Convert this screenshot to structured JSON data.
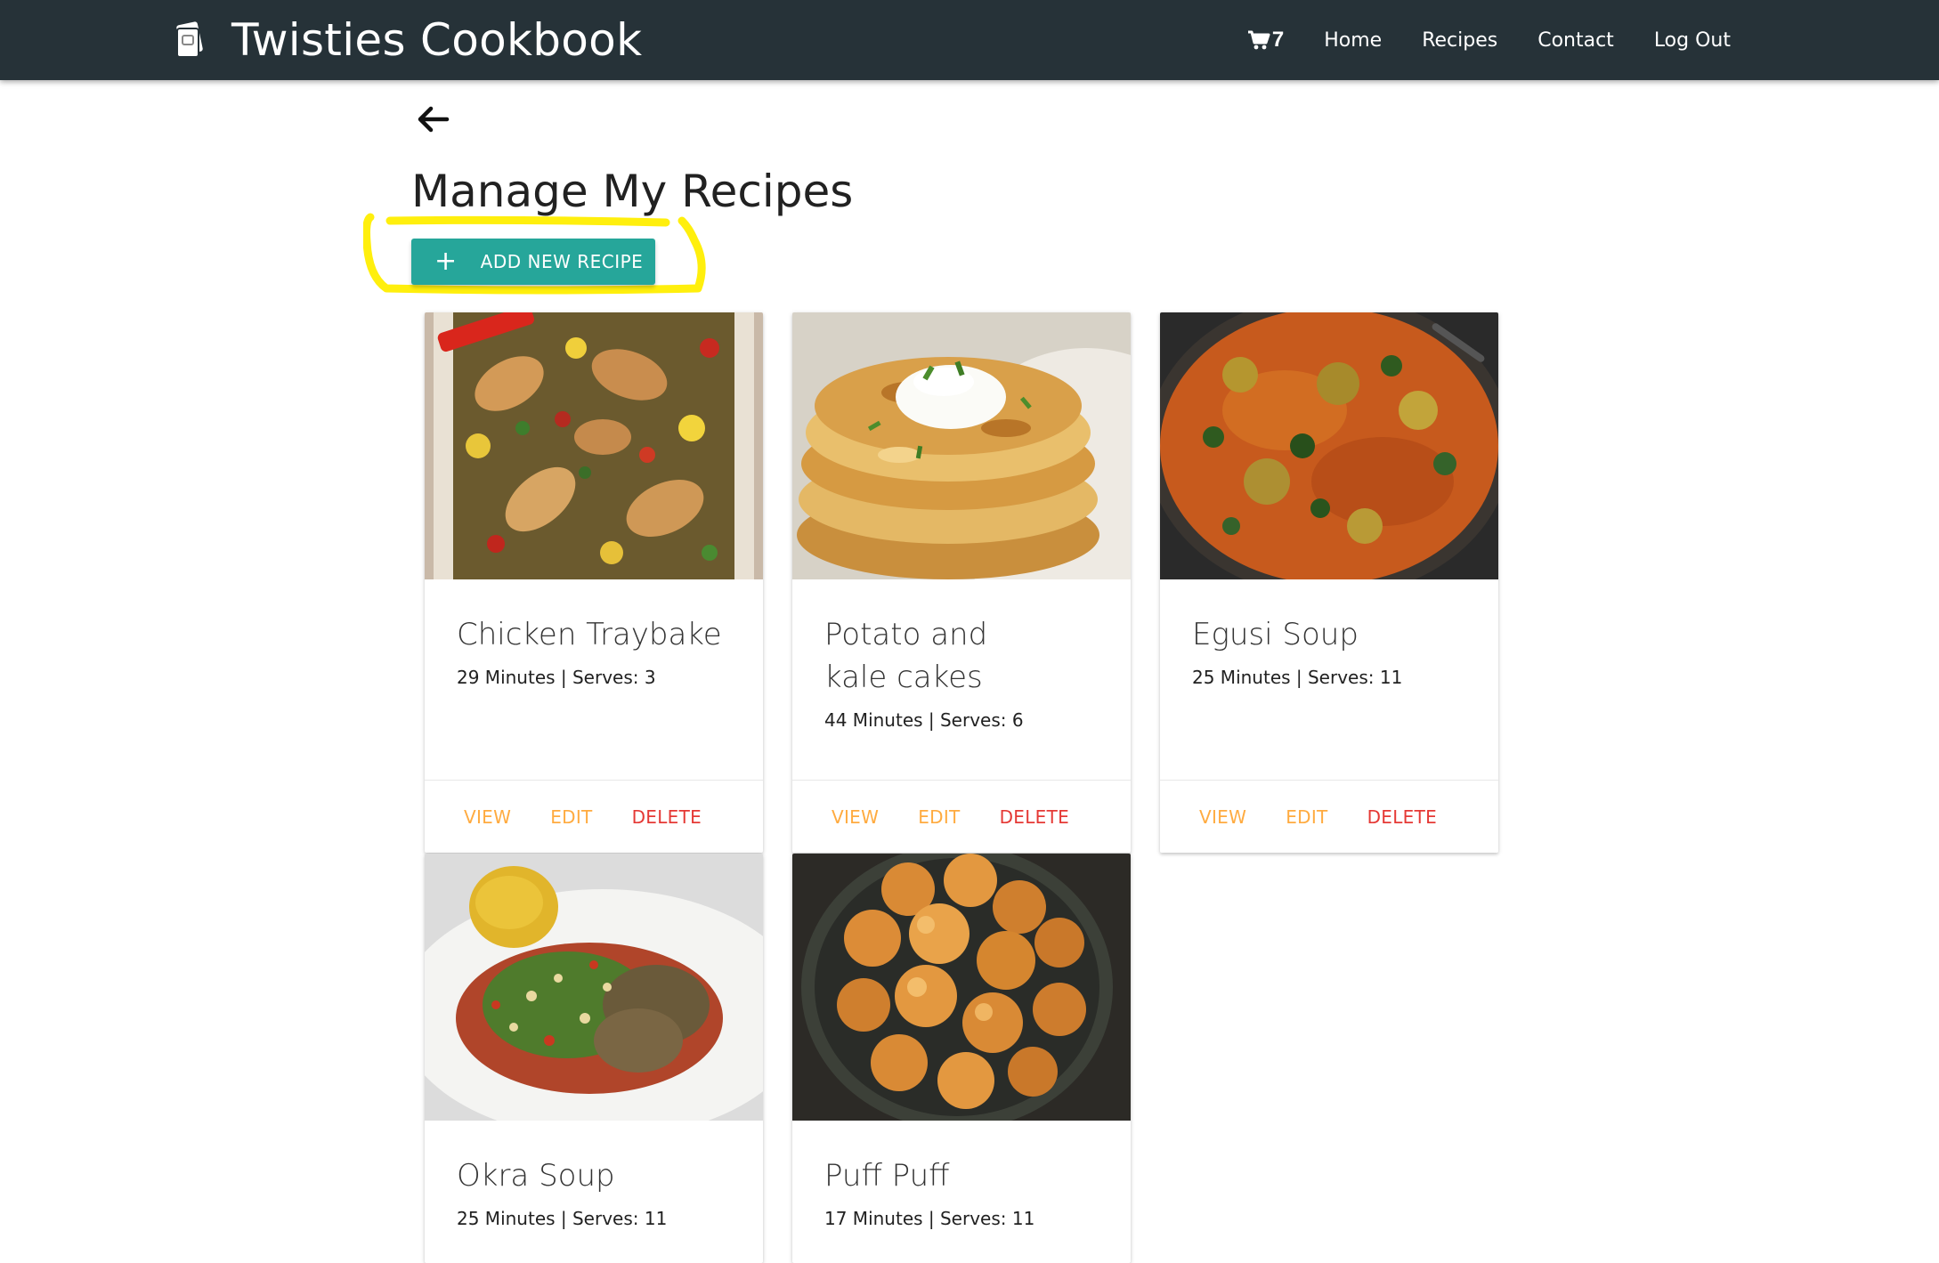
{
  "navbar": {
    "brand": "Twisties Cookbook",
    "cart_count": "7",
    "links": [
      "Home",
      "Recipes",
      "Contact",
      "Log Out"
    ]
  },
  "page": {
    "title": "Manage My Recipes",
    "add_button": "ADD NEW RECIPE"
  },
  "actions": {
    "view": "VIEW",
    "edit": "EDIT",
    "delete": "DELETE"
  },
  "recipes": [
    {
      "title": "Chicken Traybake",
      "meta": "29 Minutes | Serves: 3"
    },
    {
      "title": "Potato and kale cakes",
      "meta": "44 Minutes | Serves: 6"
    },
    {
      "title": "Egusi Soup",
      "meta": "25 Minutes | Serves: 11"
    },
    {
      "title": "Okra Soup",
      "meta": "25 Minutes | Serves: 11"
    },
    {
      "title": "Puff Puff",
      "meta": "17 Minutes | Serves: 11"
    }
  ],
  "colors": {
    "navbar": "#263238",
    "accent_button": "#26a69a",
    "action_orange": "#ffab40",
    "action_red": "#e53935",
    "highlight": "#ffee00"
  }
}
